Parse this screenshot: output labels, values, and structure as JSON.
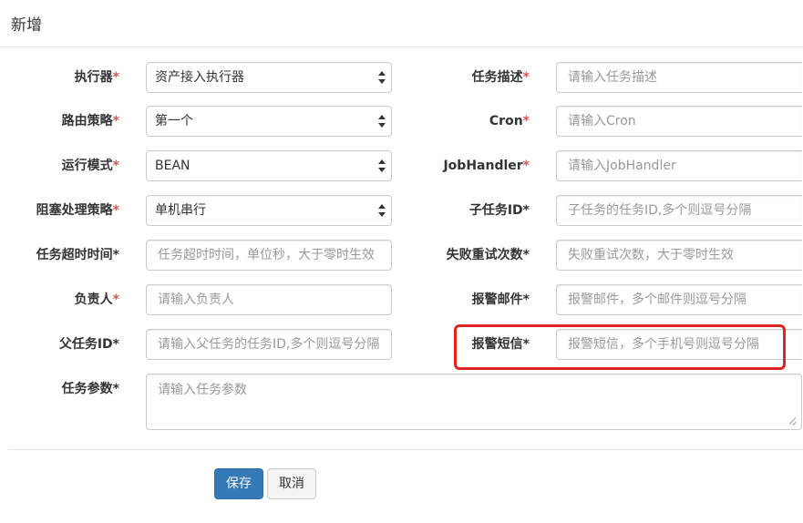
{
  "header": {
    "title": "新增"
  },
  "required_mark": "*",
  "left_fields": [
    {
      "label": "执行器",
      "required_red": true,
      "type": "select",
      "value": "资产接入执行器"
    },
    {
      "label": "路由策略",
      "required_red": true,
      "type": "select",
      "value": "第一个"
    },
    {
      "label": "运行模式",
      "required_red": true,
      "type": "select",
      "value": "BEAN"
    },
    {
      "label": "阻塞处理策略",
      "required_red": true,
      "type": "select",
      "value": "单机串行"
    },
    {
      "label": "任务超时时间",
      "required_red": false,
      "type": "input",
      "placeholder": "任务超时时间，单位秒，大于零时生效"
    },
    {
      "label": "负责人",
      "required_red": true,
      "type": "input",
      "placeholder": "请输入负责人"
    },
    {
      "label": "父任务ID",
      "required_red": false,
      "type": "input",
      "placeholder": "请输入父任务的任务ID,多个则逗号分隔"
    }
  ],
  "right_fields": [
    {
      "label": "任务描述",
      "required_red": true,
      "placeholder": "请输入任务描述"
    },
    {
      "label": "Cron",
      "required_red": true,
      "placeholder": "请输入Cron"
    },
    {
      "label": "JobHandler",
      "required_red": true,
      "placeholder": "请输入JobHandler"
    },
    {
      "label": "子任务ID",
      "required_red": false,
      "placeholder": "子任务的任务ID,多个则逗号分隔"
    },
    {
      "label": "失败重试次数",
      "required_red": false,
      "placeholder": "失败重试次数，大于零时生效"
    },
    {
      "label": "报警邮件",
      "required_red": false,
      "placeholder": "报警邮件，多个邮件则逗号分隔"
    },
    {
      "label": "报警短信",
      "required_red": false,
      "placeholder": "报警短信，多个手机号则逗号分隔"
    }
  ],
  "params_field": {
    "label": "任务参数",
    "required_red": false,
    "placeholder": "请输入任务参数"
  },
  "buttons": {
    "save": "保存",
    "cancel": "取消"
  },
  "colors": {
    "required": "#d9534f",
    "primary": "#337ab7",
    "highlight": "#e52222"
  }
}
